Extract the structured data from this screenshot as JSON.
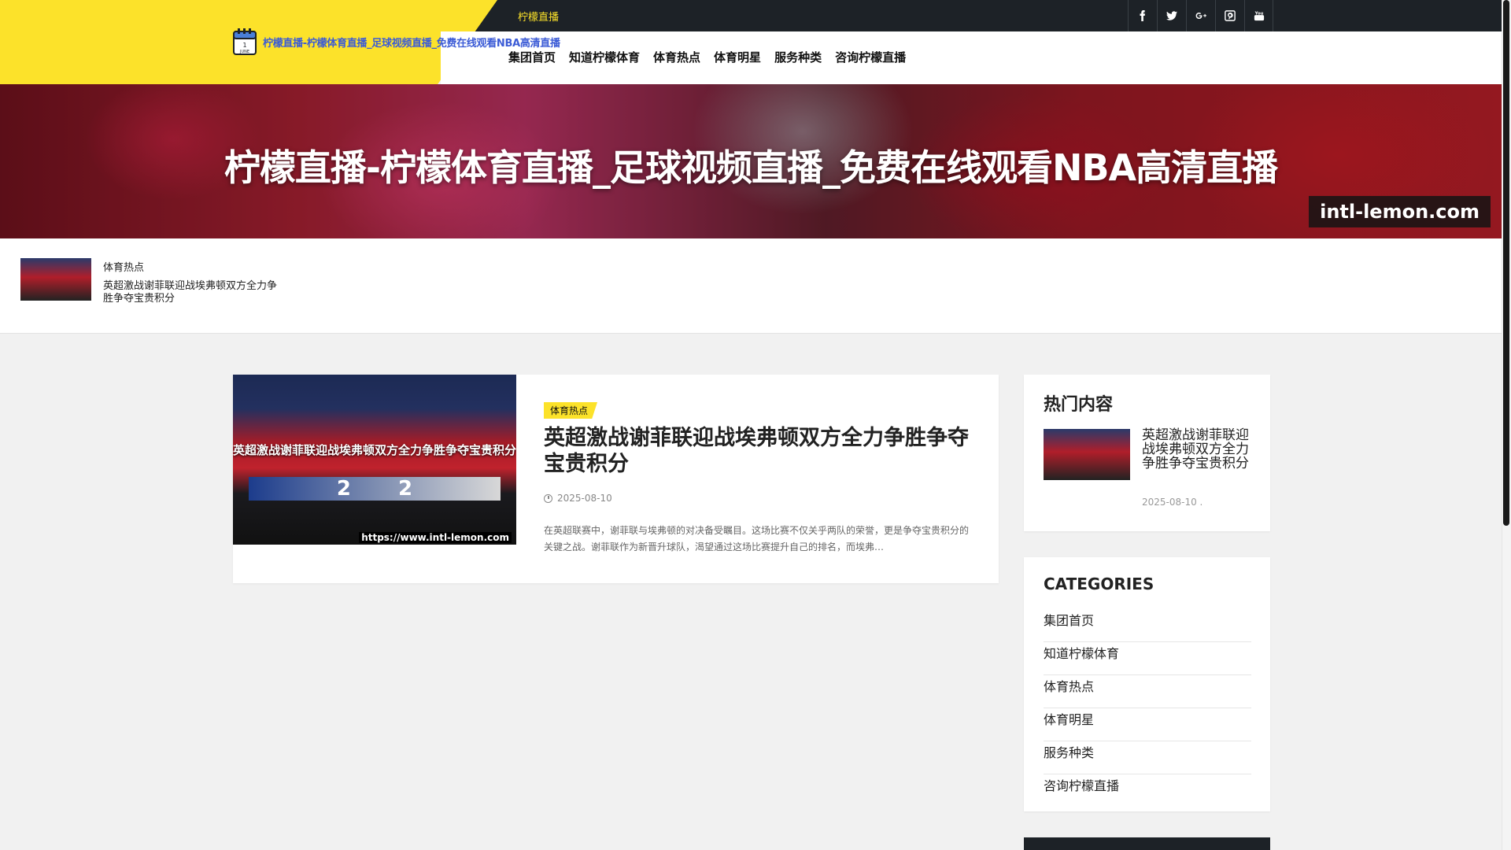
{
  "topbar": {
    "title": "柠檬直播",
    "social": [
      {
        "icon": "facebook-icon",
        "glyph": "f"
      },
      {
        "icon": "twitter-icon",
        "glyph": "t"
      },
      {
        "icon": "google-plus-icon",
        "glyph": "G+"
      },
      {
        "icon": "pinterest-icon",
        "glyph": "p"
      },
      {
        "icon": "youtube-icon",
        "glyph": "You"
      }
    ]
  },
  "header": {
    "site_name": "柠檬直播-柠檬体育直播_足球视频直播_免费在线观看NBA高清直播",
    "logo_text": "1 JUNE",
    "nav": [
      "集团首页",
      "知道柠檬体育",
      "体育热点",
      "体育明星",
      "服务种类",
      "咨询柠檬直播"
    ]
  },
  "hero": {
    "title": "柠檬直播-柠檬体育直播_足球视频直播_免费在线观看NBA高清直播",
    "watermark": "intl-lemon.com"
  },
  "ticker": {
    "category": "体育热点",
    "title": "英超激战谢菲联迎战埃弗顿双方全力争胜争夺宝贵积分"
  },
  "post": {
    "category": "体育热点",
    "title": "英超激战谢菲联迎战埃弗顿双方全力争胜争夺宝贵积分",
    "date": "2025-08-10",
    "excerpt": "在英超联赛中，谢菲联与埃弗顿的对决备受瞩目。这场比赛不仅关乎两队的荣誉，更是争夺宝贵积分的关键之战。谢菲联作为新晋升球队，渴望通过这场比赛提升自己的排名，而埃弗…",
    "thumb_headline": "英超激战谢菲联迎战埃弗顿双方全力争胜争夺宝贵积分",
    "thumb_score_home": "2",
    "thumb_score_away": "2",
    "thumb_url": "https://www.intl-lemon.com"
  },
  "sidebar": {
    "popular_title": "热门内容",
    "popular_item_title": "英超激战谢菲联迎战埃弗顿双方全力争胜争夺宝贵积分",
    "popular_item_date": "2025-08-10 .",
    "categories_title": "CATEGORIES",
    "categories": [
      "集团首页",
      "知道柠檬体育",
      "体育热点",
      "体育明星",
      "服务种类",
      "咨询柠檬直播"
    ]
  },
  "colors": {
    "accent_yellow": "#fce22a",
    "topbar_dark": "#1d2227",
    "site_name_blue": "#3b5bd6"
  }
}
